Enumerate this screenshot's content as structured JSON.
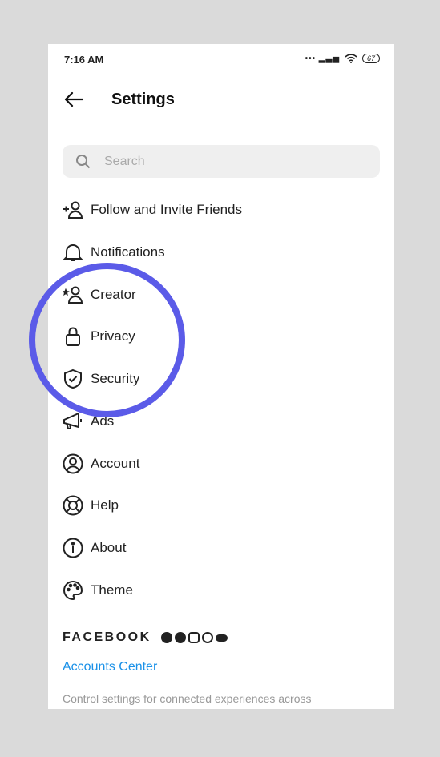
{
  "status": {
    "time": "7:16 AM",
    "battery": "67"
  },
  "header": {
    "title": "Settings"
  },
  "search": {
    "placeholder": "Search",
    "value": ""
  },
  "menu": [
    {
      "label": "Follow and Invite Friends",
      "icon": "add-person-icon"
    },
    {
      "label": "Notifications",
      "icon": "bell-icon"
    },
    {
      "label": "Creator",
      "icon": "star-person-icon"
    },
    {
      "label": "Privacy",
      "icon": "lock-icon"
    },
    {
      "label": "Security",
      "icon": "shield-icon"
    },
    {
      "label": "Ads",
      "icon": "megaphone-icon"
    },
    {
      "label": "Account",
      "icon": "account-circle-icon"
    },
    {
      "label": "Help",
      "icon": "lifebuoy-icon"
    },
    {
      "label": "About",
      "icon": "info-icon"
    },
    {
      "label": "Theme",
      "icon": "palette-icon"
    }
  ],
  "facebook": {
    "wordmark": "FACEBOOK",
    "accounts_center": "Accounts Center",
    "description": "Control settings for connected experiences across"
  },
  "colors": {
    "highlight_ring": "#5b5be8",
    "link": "#1a91e8"
  }
}
